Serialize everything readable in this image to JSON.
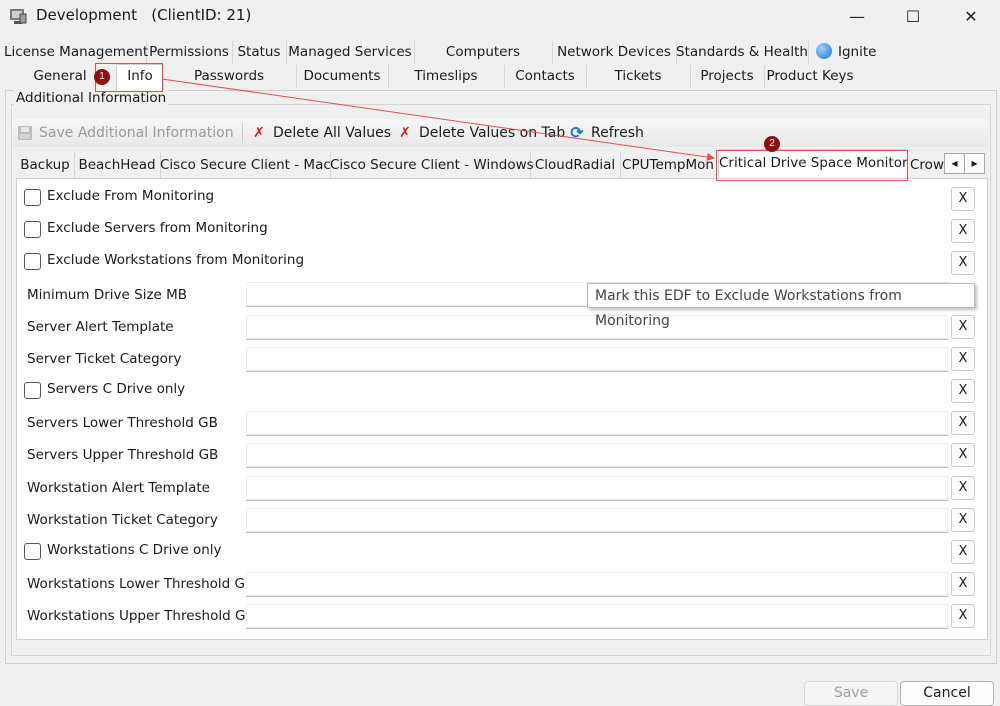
{
  "window": {
    "title": "Development",
    "client": "(ClientID: 21)",
    "minimize": "—",
    "maximize": "☐",
    "close": "✕"
  },
  "tabs_row1": [
    "License Management",
    "Permissions",
    "Status",
    "Managed Services",
    "Computers",
    "Network Devices",
    "Standards & Health",
    "Ignite"
  ],
  "tabs_row2": [
    "General",
    "Info",
    "Passwords",
    "Documents",
    "Timeslips",
    "Contacts",
    "Tickets",
    "Projects",
    "Product Keys"
  ],
  "group_label": "Additional Information",
  "toolbar": {
    "save": "Save Additional Information",
    "delete_all": "Delete All Values",
    "delete_tab": "Delete Values on Tab",
    "refresh": "Refresh"
  },
  "subtabs": [
    "Backup",
    "BeachHead",
    "Cisco Secure Client - Mac",
    "Cisco Secure Client - Windows",
    "CloudRadial",
    "CPUTempMon",
    "Critical Drive Space Monitor",
    "Crow"
  ],
  "scroll": {
    "left": "◂",
    "right": "▸"
  },
  "fields": [
    {
      "label": "Exclude From Monitoring"
    },
    {
      "label": "Exclude Servers from Monitoring"
    },
    {
      "label": "Exclude Workstations from Monitoring"
    },
    {
      "label": "Minimum Drive Size MB"
    },
    {
      "label": "Server Alert Template"
    },
    {
      "label": "Server Ticket Category"
    },
    {
      "label": "Servers C Drive only"
    },
    {
      "label": "Servers Lower Threshold GB"
    },
    {
      "label": "Servers Upper Threshold GB"
    },
    {
      "label": "Workstation Alert Template"
    },
    {
      "label": "Workstation Ticket Category"
    },
    {
      "label": "Workstations C Drive only"
    },
    {
      "label": "Workstations Lower Threshold GB"
    },
    {
      "label": "Workstations Upper Threshold GB"
    }
  ],
  "x_label": "X",
  "tooltip": "Mark this EDF to Exclude Workstations from Monitoring",
  "buttons": {
    "save": "Save",
    "cancel": "Cancel"
  },
  "annotations": {
    "badge1": "1",
    "badge2": "2"
  },
  "colors": {
    "annotation": "#e05050",
    "badge": "#8b1010",
    "tab_selected": "#ffffff"
  }
}
